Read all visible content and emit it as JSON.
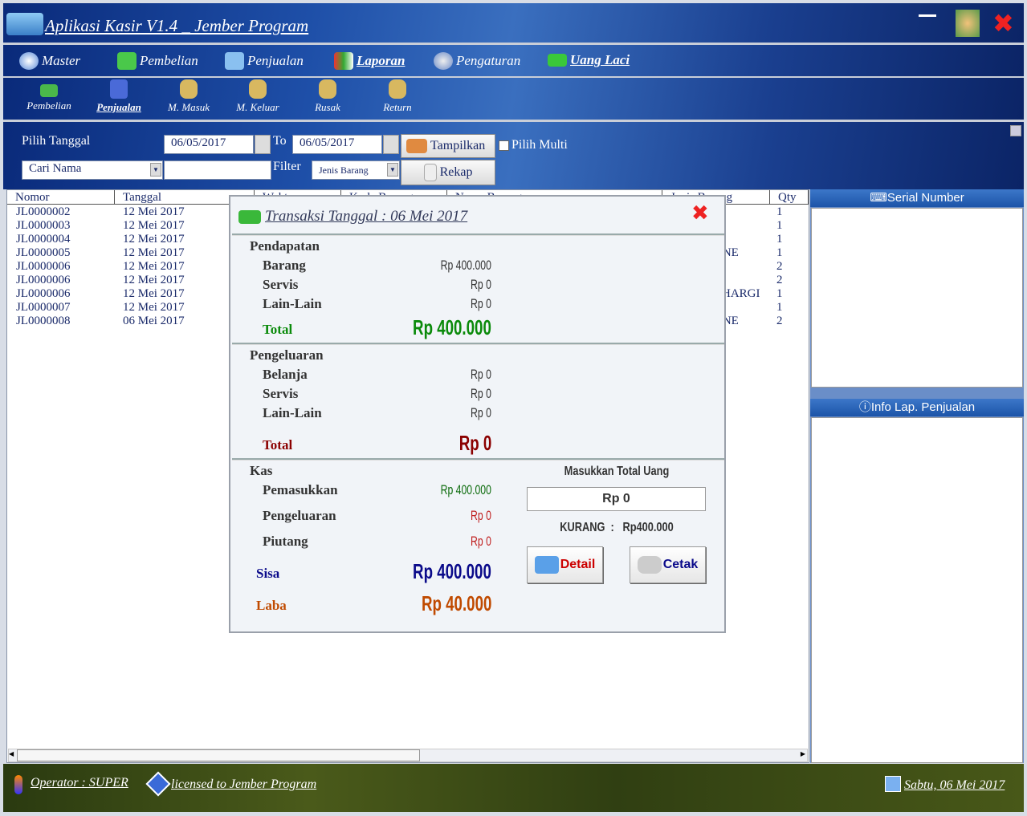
{
  "app": {
    "title": "Aplikasi Kasir V1.4 _ Jember Program"
  },
  "menu": [
    {
      "label": "Master",
      "icon": "disc-icon"
    },
    {
      "label": "Pembelian",
      "icon": "arrow-down-icon"
    },
    {
      "label": "Penjualan",
      "icon": "calculator-icon"
    },
    {
      "label": "Laporan",
      "icon": "report-icon"
    },
    {
      "label": "Pengaturan",
      "icon": "gears-icon"
    },
    {
      "label": "Uang Laci",
      "icon": "money-icon"
    }
  ],
  "toolbar": [
    {
      "label": "Pembelian"
    },
    {
      "label": "Penjualan"
    },
    {
      "label": "M. Masuk"
    },
    {
      "label": "M. Keluar"
    },
    {
      "label": "Rusak"
    },
    {
      "label": "Return"
    }
  ],
  "filter": {
    "pilih_tanggal": "Pilih Tanggal",
    "date_from": "06/05/2017",
    "to": "To",
    "date_to": "06/05/2017",
    "tampilkan": "Tampilkan",
    "pilih_multi": "Pilih Multi",
    "cari": "Cari Nama",
    "search_value": "",
    "filter_label": "Filter",
    "jenis": "Jenis Barang",
    "rekap": "Rekap"
  },
  "table": {
    "columns": [
      "Nomor",
      "Tanggal",
      "Waktu",
      "Kode Barang",
      "Nama Barang",
      "Jenis Barang",
      "Qty"
    ],
    "rows": [
      [
        "JL0000002",
        "12 Mei 2017",
        "",
        "1"
      ],
      [
        "JL0000003",
        "12 Mei 2017",
        "",
        "1"
      ],
      [
        "JL0000004",
        "12 Mei 2017",
        "",
        "1"
      ],
      [
        "JL0000005",
        "12 Mei 2017",
        "ONE",
        "1"
      ],
      [
        "JL0000006",
        "12 Mei 2017",
        "N",
        "2"
      ],
      [
        "JL0000006",
        "12 Mei 2017",
        "N",
        "2"
      ],
      [
        "JL0000006",
        "12 Mei 2017",
        "CHARGI",
        "1"
      ],
      [
        "JL0000007",
        "12 Mei 2017",
        "N",
        "1"
      ],
      [
        "JL0000008",
        "06 Mei 2017",
        "ONE",
        "2"
      ]
    ]
  },
  "right": {
    "serial": "Serial Number",
    "info": "Info Lap. Penjualan"
  },
  "status": {
    "operator": "Operator : SUPER",
    "license": "licensed to Jember Program",
    "date": "Sabtu, 06 Mei 2017"
  },
  "dialog": {
    "title": "Transaksi Tanggal : 06 Mei 2017",
    "pendapatan": {
      "label": "Pendapatan",
      "barang": "Barang",
      "barang_v": "Rp 400.000",
      "servis": "Servis",
      "servis_v": "Rp 0",
      "lain": "Lain-Lain",
      "lain_v": "Rp 0",
      "total": "Total",
      "total_v": "Rp 400.000"
    },
    "pengeluaran": {
      "label": "Pengeluaran",
      "belanja": "Belanja",
      "belanja_v": "Rp 0",
      "servis": "Servis",
      "servis_v": "Rp 0",
      "lain": "Lain-Lain",
      "lain_v": "Rp 0",
      "total": "Total",
      "total_v": "Rp 0"
    },
    "kas": {
      "label": "Kas",
      "pemasukkan": "Pemasukkan",
      "pemasukkan_v": "Rp 400.000",
      "pengeluaran": "Pengeluaran",
      "pengeluaran_v": "Rp 0",
      "piutang": "Piutang",
      "piutang_v": "Rp 0",
      "sisa": "Sisa",
      "sisa_v": "Rp 400.000",
      "laba": "Laba",
      "laba_v": "Rp 40.000"
    },
    "masukkan": "Masukkan Total Uang",
    "uang_value": "Rp 0",
    "kurang": "KURANG  :   Rp400.000",
    "detail": "Detail",
    "cetak": "Cetak"
  },
  "colors": {
    "green": "#0a8a0a",
    "maroon": "#8b0000",
    "navy": "#0a0a8a",
    "orange": "#c04a00"
  }
}
